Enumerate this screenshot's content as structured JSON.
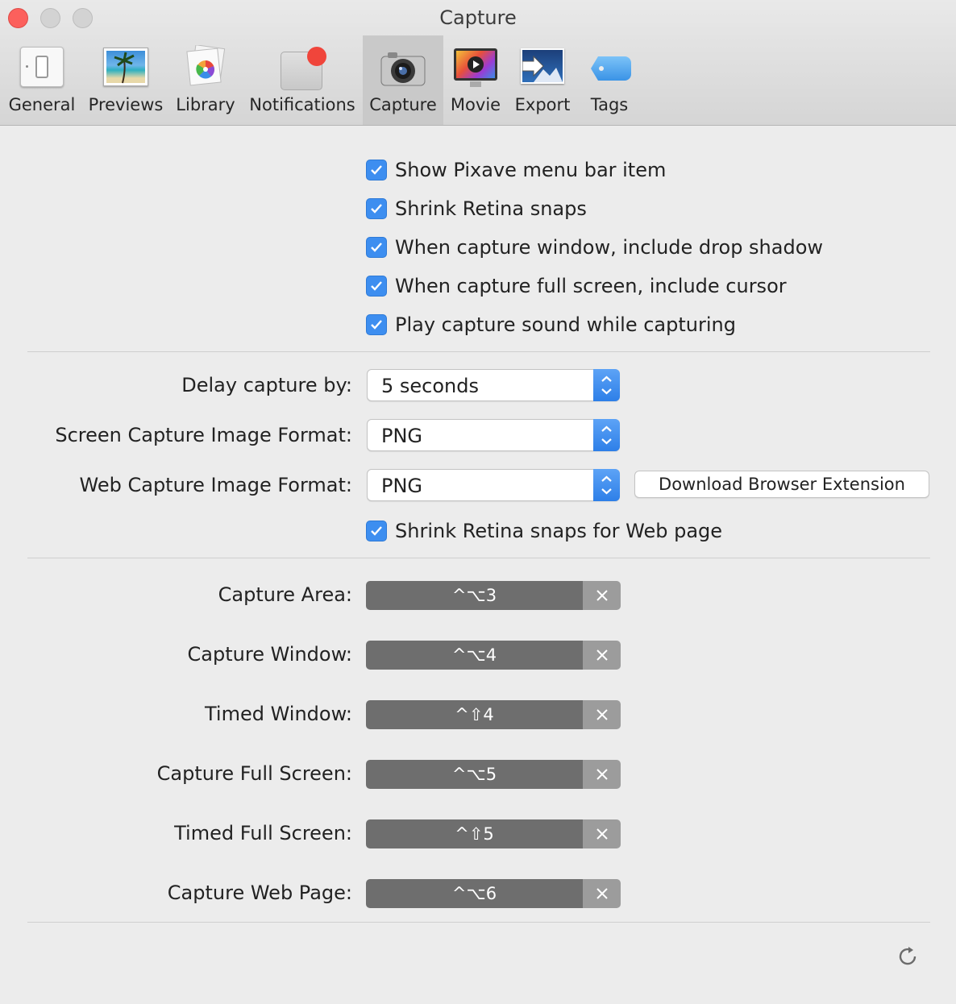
{
  "window": {
    "title": "Capture"
  },
  "tabs": [
    {
      "label": "General",
      "icon": "switch-icon"
    },
    {
      "label": "Previews",
      "icon": "photo-icon"
    },
    {
      "label": "Library",
      "icon": "library-icon"
    },
    {
      "label": "Notifications",
      "icon": "notifications-icon"
    },
    {
      "label": "Capture",
      "icon": "camera-icon",
      "active": true
    },
    {
      "label": "Movie",
      "icon": "movie-icon"
    },
    {
      "label": "Export",
      "icon": "export-icon"
    },
    {
      "label": "Tags",
      "icon": "tag-icon"
    }
  ],
  "options": [
    {
      "label": "Show Pixave menu bar item",
      "checked": true
    },
    {
      "label": "Shrink Retina snaps",
      "checked": true
    },
    {
      "label": "When capture window, include drop shadow",
      "checked": true
    },
    {
      "label": "When capture full screen, include cursor",
      "checked": true
    },
    {
      "label": "Play capture sound while capturing",
      "checked": true
    }
  ],
  "delay": {
    "label": "Delay capture by:",
    "value": "5 seconds"
  },
  "screen_format": {
    "label": "Screen Capture Image Format:",
    "value": "PNG"
  },
  "web_format": {
    "label": "Web Capture Image Format:",
    "value": "PNG",
    "button": "Download Browser Extension"
  },
  "web_shrink": {
    "label": "Shrink Retina snaps for Web page",
    "checked": true
  },
  "shortcuts": [
    {
      "label": "Capture Area:",
      "keys": "^⌥3"
    },
    {
      "label": "Capture Window:",
      "keys": "^⌥4"
    },
    {
      "label": "Timed Window:",
      "keys": "^⇧4"
    },
    {
      "label": "Capture Full Screen:",
      "keys": "^⌥5"
    },
    {
      "label": "Timed Full Screen:",
      "keys": "^⇧5"
    },
    {
      "label": "Capture Web Page:",
      "keys": "^⌥6"
    }
  ],
  "colors": {
    "accent": "#3d8ef0",
    "shortcut_bg": "#6e6e6e",
    "close": "#fc605c"
  }
}
